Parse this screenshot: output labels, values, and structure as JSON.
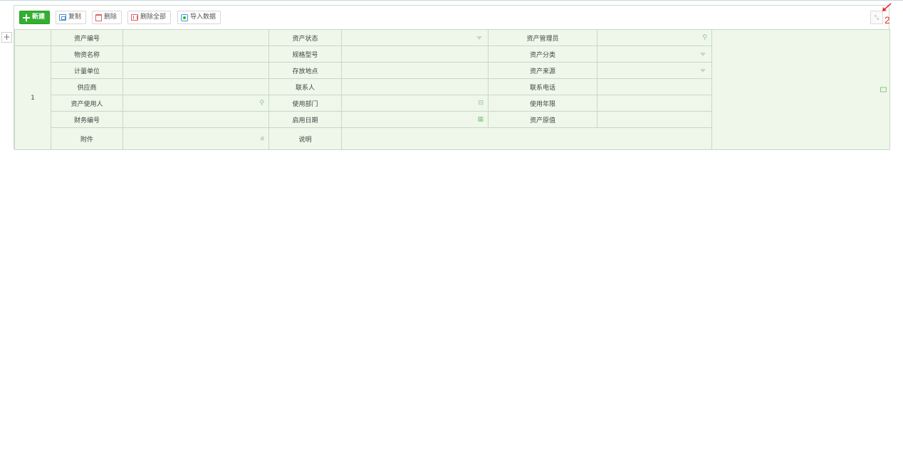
{
  "toolbar": {
    "new_label": "新建",
    "copy_label": "复制",
    "delete_label": "删除",
    "delete_all_label": "删除全部",
    "import_label": "导入数据",
    "collapse_glyph": "⤡",
    "add_row_glyph": "+"
  },
  "marker": "2",
  "form": {
    "row_no": "1",
    "labels": {
      "asset_no": "资产编号",
      "asset_status": "资产状态",
      "asset_manager": "资产管理员",
      "material_name": "物资名称",
      "spec_model": "规格型号",
      "asset_category": "资产分类",
      "unit": "计量单位",
      "location": "存放地点",
      "asset_source": "资产来源",
      "supplier": "供应商",
      "contact": "联系人",
      "contact_phone": "联系电话",
      "asset_user": "资产使用人",
      "use_dept": "使用部门",
      "use_years": "使用年限",
      "finance_no": "财务编号",
      "start_date": "启用日期",
      "original_value": "资产原值",
      "attachment": "附件",
      "description": "说明"
    }
  },
  "colors": {
    "primary_button": "#33b031",
    "cell_background": "#eef7e9",
    "grid_border": "#c8d8c8",
    "marker": "#e53030"
  }
}
